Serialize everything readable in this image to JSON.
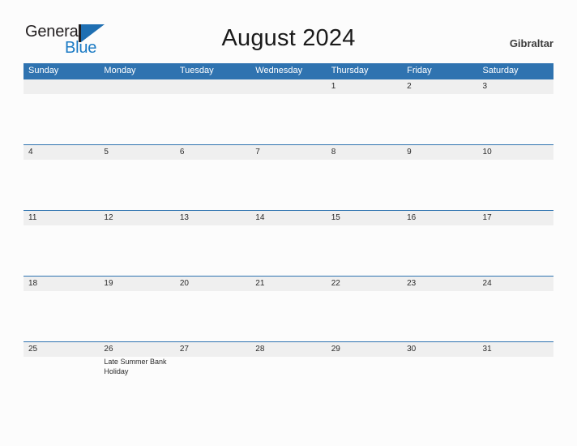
{
  "brand": {
    "name_part1": "General",
    "name_part2": "Blue",
    "mark": "triangle-logo-mark",
    "colors": {
      "dark": "#231f20",
      "blue": "#1a7ac4",
      "mark_blue": "#1f6fb2"
    }
  },
  "header": {
    "title": "August 2024",
    "region": "Gibraltar"
  },
  "calendar": {
    "header_bg": "#2f73b0",
    "date_band_bg": "#efefef",
    "weekdays": [
      "Sunday",
      "Monday",
      "Tuesday",
      "Wednesday",
      "Thursday",
      "Friday",
      "Saturday"
    ],
    "weeks": [
      {
        "days": [
          {
            "num": "",
            "event": ""
          },
          {
            "num": "",
            "event": ""
          },
          {
            "num": "",
            "event": ""
          },
          {
            "num": "",
            "event": ""
          },
          {
            "num": "1",
            "event": ""
          },
          {
            "num": "2",
            "event": ""
          },
          {
            "num": "3",
            "event": ""
          }
        ]
      },
      {
        "days": [
          {
            "num": "4",
            "event": ""
          },
          {
            "num": "5",
            "event": ""
          },
          {
            "num": "6",
            "event": ""
          },
          {
            "num": "7",
            "event": ""
          },
          {
            "num": "8",
            "event": ""
          },
          {
            "num": "9",
            "event": ""
          },
          {
            "num": "10",
            "event": ""
          }
        ]
      },
      {
        "days": [
          {
            "num": "11",
            "event": ""
          },
          {
            "num": "12",
            "event": ""
          },
          {
            "num": "13",
            "event": ""
          },
          {
            "num": "14",
            "event": ""
          },
          {
            "num": "15",
            "event": ""
          },
          {
            "num": "16",
            "event": ""
          },
          {
            "num": "17",
            "event": ""
          }
        ]
      },
      {
        "days": [
          {
            "num": "18",
            "event": ""
          },
          {
            "num": "19",
            "event": ""
          },
          {
            "num": "20",
            "event": ""
          },
          {
            "num": "21",
            "event": ""
          },
          {
            "num": "22",
            "event": ""
          },
          {
            "num": "23",
            "event": ""
          },
          {
            "num": "24",
            "event": ""
          }
        ]
      },
      {
        "days": [
          {
            "num": "25",
            "event": ""
          },
          {
            "num": "26",
            "event": "Late Summer Bank Holiday"
          },
          {
            "num": "27",
            "event": ""
          },
          {
            "num": "28",
            "event": ""
          },
          {
            "num": "29",
            "event": ""
          },
          {
            "num": "30",
            "event": ""
          },
          {
            "num": "31",
            "event": ""
          }
        ]
      }
    ]
  }
}
